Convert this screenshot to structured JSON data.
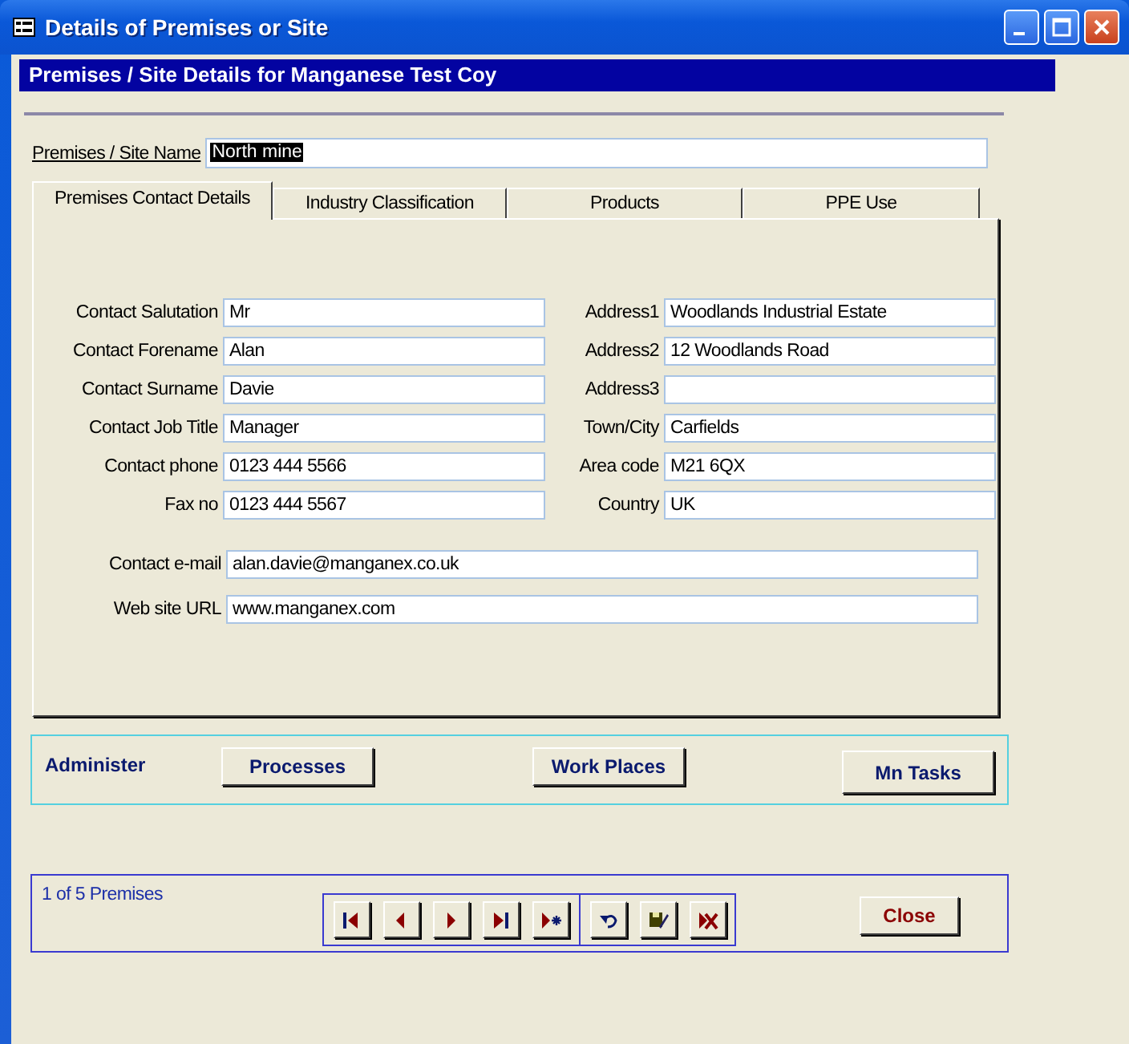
{
  "window": {
    "title": "Details of Premises or Site"
  },
  "header": "Premises / Site Details for Manganese Test Coy",
  "site_name": {
    "label": "Premises / Site Name",
    "value": "North mine",
    "highlighted": true
  },
  "tabs": [
    {
      "label": "Premises Contact Details",
      "selected": true
    },
    {
      "label": "Industry Classification",
      "selected": false
    },
    {
      "label": "Products",
      "selected": false
    },
    {
      "label": "PPE Use",
      "selected": false
    }
  ],
  "contact_fields": [
    {
      "label": "Contact Salutation",
      "value": "Mr"
    },
    {
      "label": "Contact Forename",
      "value": "Alan"
    },
    {
      "label": "Contact Surname",
      "value": "Davie"
    },
    {
      "label": "Contact Job Title",
      "value": "Manager"
    },
    {
      "label": "Contact phone",
      "value": "0123 444 5566"
    },
    {
      "label": "Fax no",
      "value": "0123 444 5567"
    }
  ],
  "address_fields": [
    {
      "label": "Address1",
      "value": "Woodlands Industrial Estate"
    },
    {
      "label": "Address2",
      "value": "12 Woodlands Road"
    },
    {
      "label": "Address3"
    },
    {
      "label": "Town/City",
      "value": "Carfields"
    },
    {
      "label": "Area code",
      "value": "M21 6QX"
    },
    {
      "label": "Country",
      "value": "UK"
    }
  ],
  "web_fields": [
    {
      "label": "Contact e-mail",
      "value": "alan.davie@manganex.co.uk"
    },
    {
      "label": "Web site URL",
      "value": "www.manganex.com"
    }
  ],
  "administer": {
    "label": "Administer",
    "buttons": [
      "Processes",
      "Work Places",
      "Mn Tasks"
    ]
  },
  "navigation": {
    "record_count": "1 of 5 Premises",
    "close_button": "Close"
  }
}
